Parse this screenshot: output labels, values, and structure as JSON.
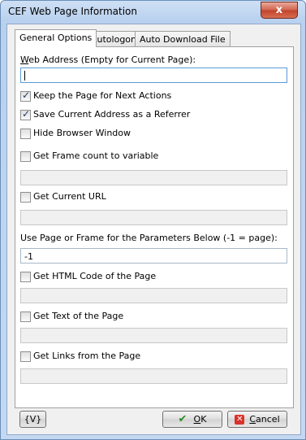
{
  "window": {
    "title": "CEF Web Page Information",
    "close_label": "x"
  },
  "tabs": [
    {
      "label": "General Options",
      "active": true
    },
    {
      "label": "Autologon",
      "active": false
    },
    {
      "label": "Auto Download File",
      "active": false
    }
  ],
  "general": {
    "web_address": {
      "label_accel": "W",
      "label_rest": "eb Address (Empty for Current Page):",
      "value": ""
    },
    "keep_page": {
      "label": "Keep the Page for Next Actions",
      "checked": true
    },
    "save_address": {
      "label": "Save Current Address as a Referrer",
      "checked": true
    },
    "hide_browser": {
      "label": "Hide Browser Window",
      "checked": false
    },
    "frame_count": {
      "label": "Get Frame count to variable",
      "checked": false,
      "value": ""
    },
    "current_url": {
      "label": "Get Current URL",
      "checked": false,
      "value": ""
    },
    "page_or_frame": {
      "label": "Use Page or Frame for the Parameters Below (-1 = page):",
      "value": "-1"
    },
    "html_code": {
      "label": "Get HTML Code of the Page",
      "checked": false,
      "value": ""
    },
    "text_of_page": {
      "label": "Get Text of the Page",
      "checked": false,
      "value": ""
    },
    "links": {
      "label": "Get Links from the Page",
      "checked": false,
      "value": ""
    }
  },
  "buttons": {
    "variables": "{V}",
    "ok_accel": "O",
    "ok_rest": "K",
    "cancel_accel": "C",
    "cancel_rest": "ancel"
  },
  "icons": {
    "ok": "check-icon",
    "cancel": "cancel-x-icon",
    "close": "close-icon"
  }
}
